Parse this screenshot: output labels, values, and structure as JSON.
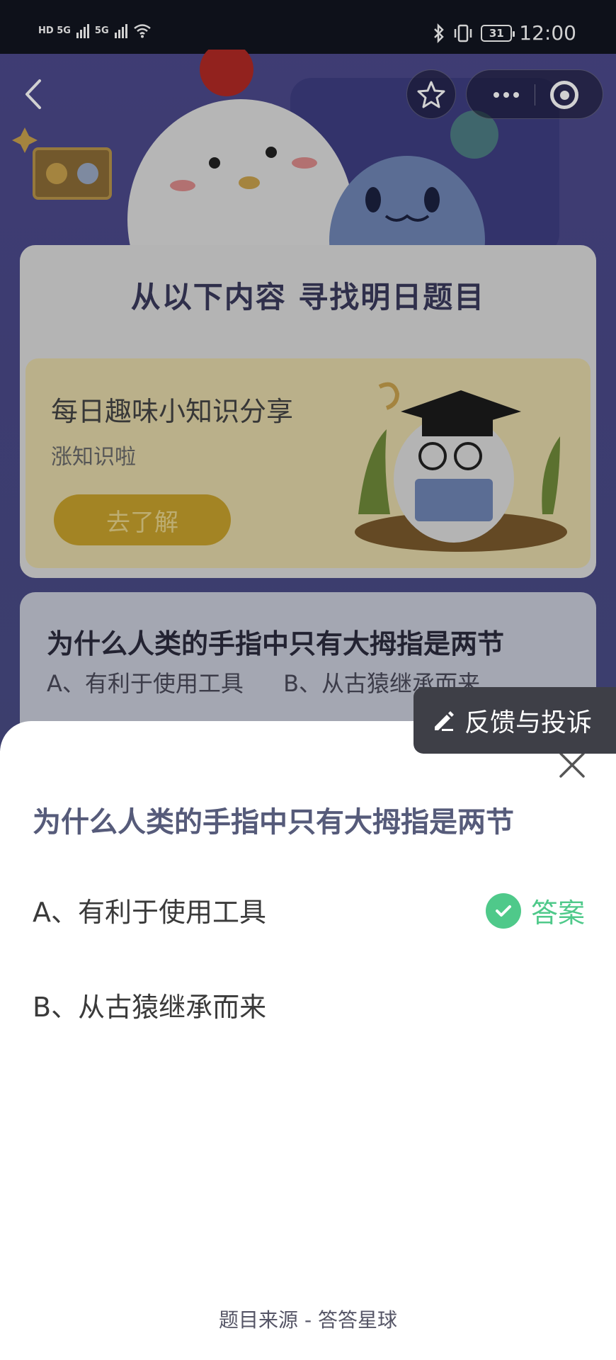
{
  "status_bar": {
    "network_left": "HD 5G",
    "network_right": "5G",
    "battery": "31",
    "time": "12:00"
  },
  "header": {
    "back_icon": "chevron-left-icon",
    "favorite_icon": "star-icon",
    "more_icon": "more-dots-icon",
    "target_icon": "target-icon"
  },
  "background_page": {
    "card_title": "从以下内容 寻找明日题目",
    "promo": {
      "title": "每日趣味小知识分享",
      "subtitle": "涨知识啦",
      "button_label": "去了解"
    },
    "question_preview": {
      "title": "为什么人类的手指中只有大拇指是两节",
      "option_a": "A、有利于使用工具",
      "option_b": "B、从古猿继承而来"
    }
  },
  "feedback": {
    "label": "反馈与投诉",
    "icon": "pencil-icon"
  },
  "sheet": {
    "question": "为什么人类的手指中只有大拇指是两节",
    "options": [
      {
        "text": "A、有利于使用工具",
        "is_answer": true
      },
      {
        "text": "B、从古猿继承而来",
        "is_answer": false
      }
    ],
    "answer_label": "答案",
    "source": "题目来源 - 答答星球",
    "close_icon": "close-icon"
  },
  "colors": {
    "answer_green": "#4fc98a",
    "question_color": "#565b7a",
    "promo_button": "#c7a12c",
    "background_purple": "#4d4a8e"
  }
}
